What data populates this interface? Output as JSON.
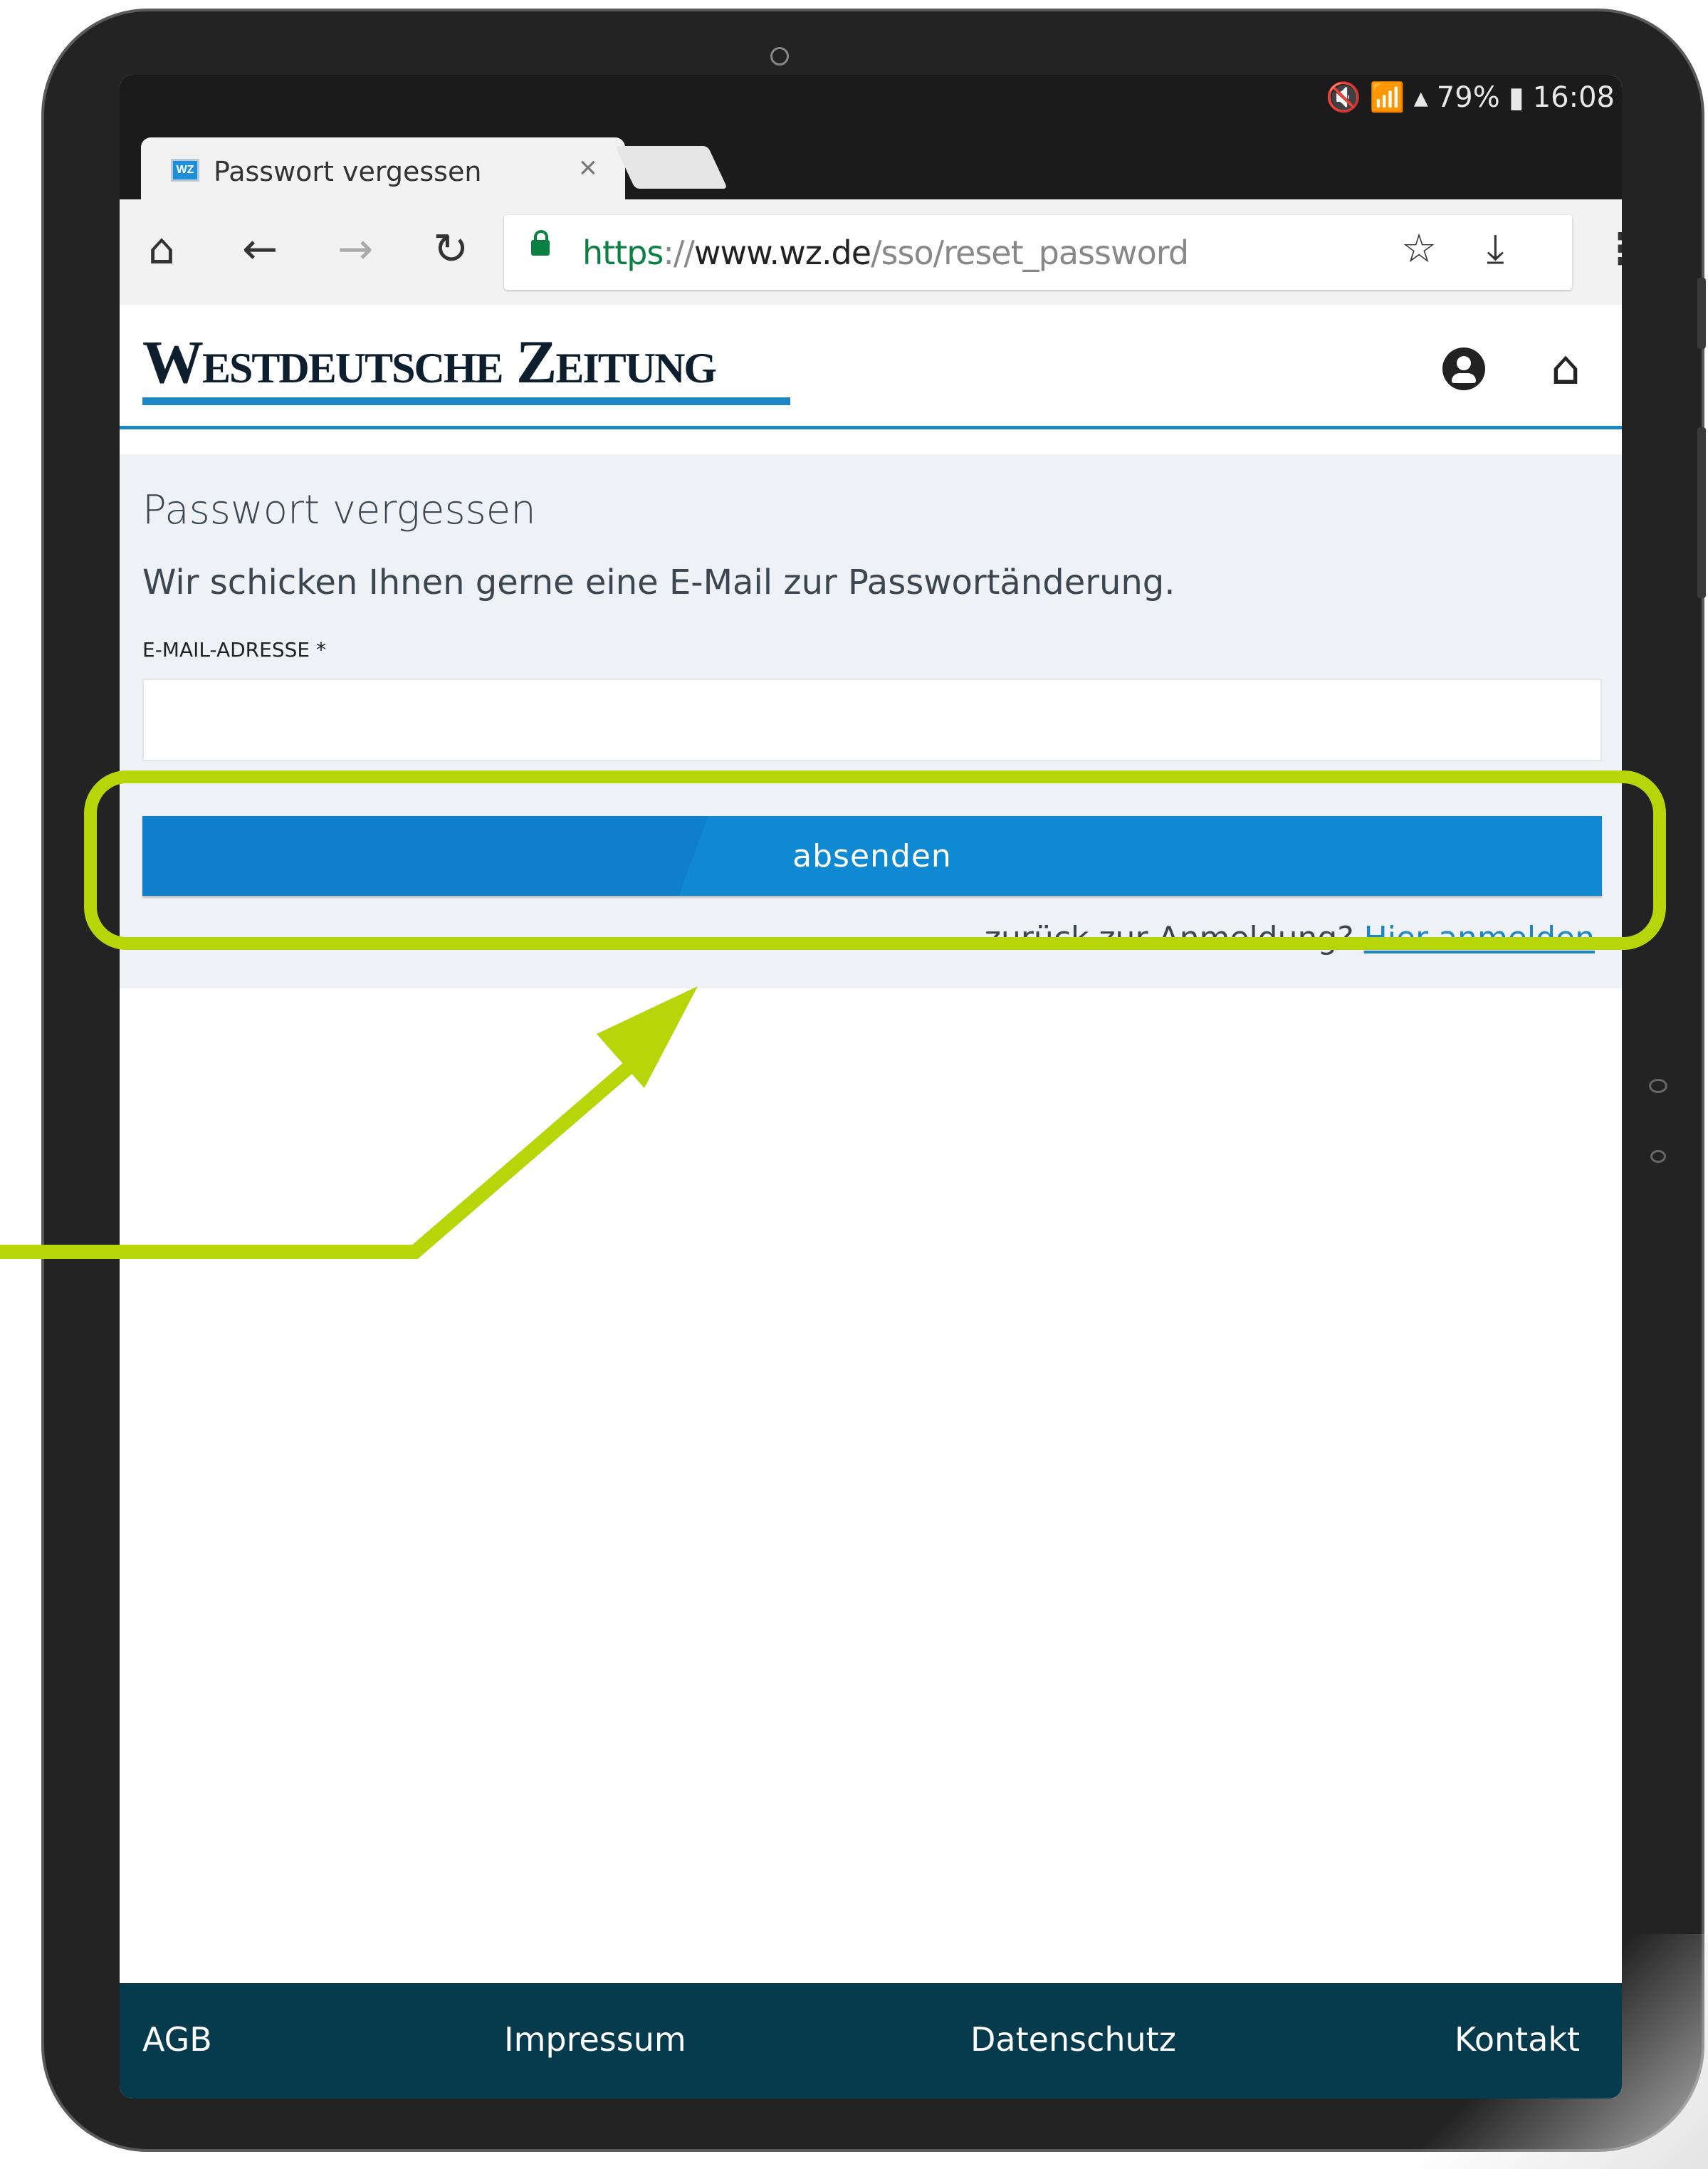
{
  "status_bar": {
    "battery": "79%",
    "time": "16:08"
  },
  "tab": {
    "title": "Passwort vergessen",
    "favicon_text": "WZ"
  },
  "address_bar": {
    "scheme": "https",
    "separator": "://",
    "host": "www.wz.de",
    "path": "/sso/reset_password"
  },
  "site": {
    "logo": "Westdeutsche Zeitung"
  },
  "form": {
    "title": "Passwort vergessen",
    "description": "Wir schicken Ihnen gerne eine E-Mail zur Passwortänderung.",
    "email_label": "E-MAIL-ADRESSE *",
    "email_value": "",
    "submit_label": "absenden",
    "footer_text": "…zurück zur Anmeldung? ",
    "footer_link": "Hier anmelden"
  },
  "footer": {
    "links": [
      "AGB",
      "Impressum",
      "Datenschutz",
      "Kontakt"
    ]
  },
  "colors": {
    "accent": "#1d86c3",
    "button": "#1089d3",
    "highlight": "#b6d60a",
    "footer_bg": "#063a4d"
  },
  "icons": [
    "home-icon",
    "back-arrow-icon",
    "forward-arrow-icon",
    "reload-icon",
    "lock-icon",
    "star-icon",
    "download-icon",
    "menu-dots-icon",
    "user-icon",
    "site-home-icon",
    "mute-icon",
    "wifi-icon",
    "signal-icon",
    "battery-icon",
    "close-icon"
  ]
}
